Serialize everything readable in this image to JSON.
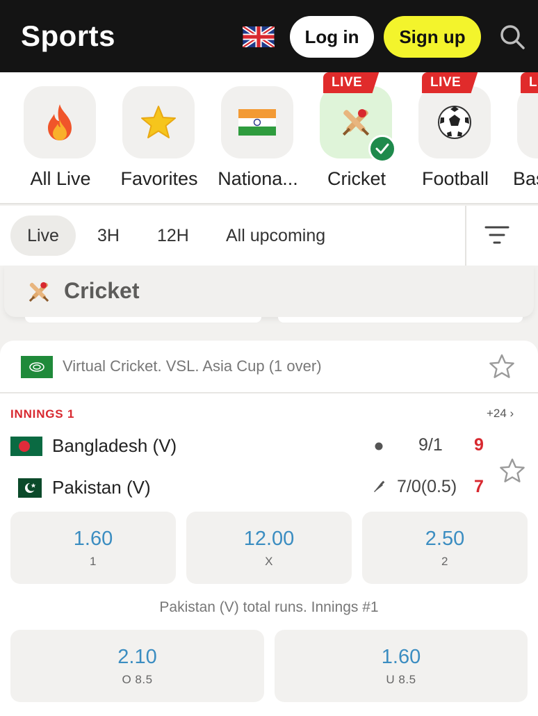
{
  "header": {
    "title": "Sports",
    "login_label": "Log in",
    "signup_label": "Sign up",
    "language_icon": "uk-flag-icon",
    "search_icon": "search-icon",
    "signup_color": "#f3f42c"
  },
  "sports": [
    {
      "label": "All Live",
      "icon": "fire-icon",
      "live": false,
      "active": false
    },
    {
      "label": "Favorites",
      "icon": "star-icon",
      "live": false,
      "active": false
    },
    {
      "label": "Nationa...",
      "icon": "india-flag-icon",
      "live": false,
      "active": false
    },
    {
      "label": "Cricket",
      "icon": "cricket-icon",
      "live": true,
      "active": true,
      "live_tag": "LIVE"
    },
    {
      "label": "Football",
      "icon": "football-icon",
      "live": true,
      "active": false,
      "live_tag": "LIVE"
    },
    {
      "label": "Bas",
      "icon": "basketball-icon",
      "live": true,
      "active": false,
      "live_tag": "L"
    }
  ],
  "filters": {
    "chips": [
      {
        "label": "Live",
        "active": true
      },
      {
        "label": "3H",
        "active": false
      },
      {
        "label": "12H",
        "active": false
      },
      {
        "label": "All upcoming",
        "active": false
      }
    ],
    "filter_icon": "filter-icon"
  },
  "section": {
    "title": "Cricket",
    "icon": "cricket-icon"
  },
  "match": {
    "league": "Virtual Cricket. VSL. Asia Cup (1 over)",
    "league_flag_icon": "saudi-flag-icon",
    "innings_label": "INNINGS 1",
    "more_markets": "+24 ›",
    "teams": [
      {
        "name": "Bangladesh (V)",
        "flag_icon": "bangladesh-flag-icon",
        "indicator": "ball-icon",
        "score": "9/1",
        "total": "9"
      },
      {
        "name": "Pakistan (V)",
        "flag_icon": "pakistan-flag-icon",
        "indicator": "bat-icon",
        "score": "7/0(0.5)",
        "total": "7"
      }
    ],
    "main_odds": [
      {
        "value": "1.60",
        "label": "1"
      },
      {
        "value": "12.00",
        "label": "X"
      },
      {
        "value": "2.50",
        "label": "2"
      }
    ],
    "market_title": "Pakistan (V) total runs. Innings #1",
    "total_odds": [
      {
        "value": "2.10",
        "label": "O 8.5"
      },
      {
        "value": "1.60",
        "label": "U 8.5"
      }
    ],
    "odds_color": "#3b8dc1",
    "live_color": "#d8282f"
  }
}
